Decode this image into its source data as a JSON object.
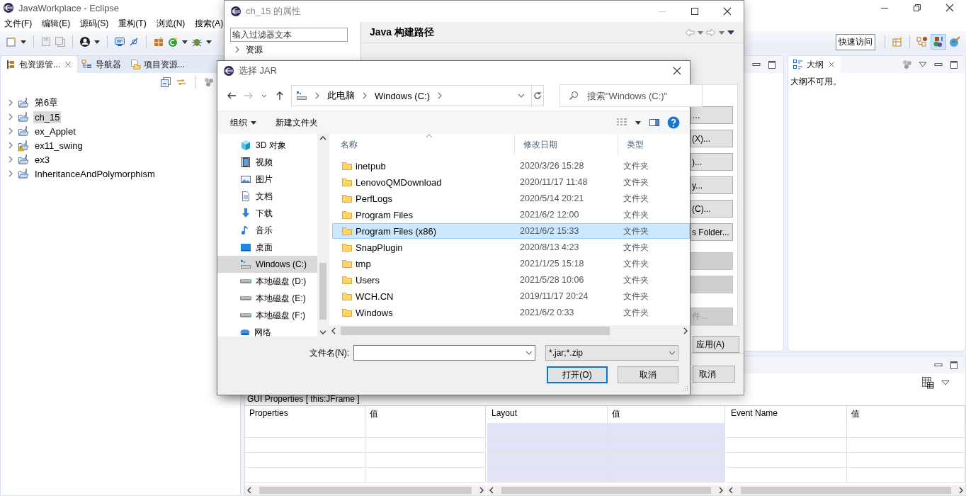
{
  "eclipse": {
    "title": "JavaWorkplace - Eclipse",
    "menu": [
      "文件(F)",
      "编辑(E)",
      "源码(S)",
      "重构(T)",
      "浏览(N)",
      "搜索(A)"
    ],
    "quick_access": "快速访问"
  },
  "package_explorer": {
    "tabs": [
      {
        "label": "包资源管...",
        "selected": true
      },
      {
        "label": "导航器",
        "selected": false
      },
      {
        "label": "项目资源...",
        "selected": false
      }
    ],
    "tree": [
      {
        "label": "第6章",
        "expanded": false,
        "selected": false,
        "warning": false
      },
      {
        "label": "ch_15",
        "expanded": false,
        "selected": true,
        "warning": false
      },
      {
        "label": "ex_Applet",
        "expanded": false,
        "selected": false,
        "warning": false
      },
      {
        "label": "ex11_swing",
        "expanded": false,
        "selected": false,
        "warning": true
      },
      {
        "label": "ex3",
        "expanded": false,
        "selected": false,
        "warning": false
      },
      {
        "label": "InheritanceAndPolymorphism",
        "expanded": false,
        "selected": false,
        "warning": false
      }
    ]
  },
  "outline": {
    "tab": "大纲",
    "message": "大纲不可用。"
  },
  "gui_properties": {
    "title": "GUI Properties [ this:JFrame ]",
    "tables": [
      {
        "columns": [
          "Properties",
          "值"
        ],
        "highlighted": false
      },
      {
        "columns": [
          "Layout",
          "值"
        ],
        "highlighted": true
      },
      {
        "columns": [
          "Event Name",
          "值"
        ],
        "highlighted": false
      }
    ]
  },
  "properties_dialog": {
    "title": "ch_15 的属性",
    "filter_placeholder": "输入过滤器文本",
    "tree": [
      {
        "label": "资源",
        "expanded": false
      }
    ],
    "page_title": "Java 构建路径",
    "buttons": [
      {
        "label": "…",
        "disabled": false
      },
      {
        "label": "(X)...",
        "disabled": false
      },
      {
        "label": ")...",
        "disabled": false
      },
      {
        "label": "y...",
        "disabled": false
      },
      {
        "label": "(C)...",
        "disabled": false
      },
      {
        "label": "s Folder...",
        "disabled": false
      },
      {
        "disabled": true
      },
      {
        "disabled": true
      },
      {
        "label": "件...",
        "disabled": true
      }
    ],
    "apply": "应用(A)",
    "cancel": "取消"
  },
  "jar_dialog": {
    "title": "选择 JAR",
    "breadcrumb": [
      "此电脑",
      "Windows (C:)"
    ],
    "search_placeholder": "搜索\"Windows (C:)\"",
    "toolbar": {
      "organize": "组织",
      "new_folder": "新建文件夹"
    },
    "nav": [
      {
        "label": "3D 对象",
        "kind": "cube",
        "selected": false
      },
      {
        "label": "视频",
        "kind": "video",
        "selected": false
      },
      {
        "label": "图片",
        "kind": "picture",
        "selected": false
      },
      {
        "label": "文档",
        "kind": "document",
        "selected": false
      },
      {
        "label": "下载",
        "kind": "download",
        "selected": false
      },
      {
        "label": "音乐",
        "kind": "music",
        "selected": false
      },
      {
        "label": "桌面",
        "kind": "desktop",
        "selected": false
      },
      {
        "label": "Windows (C:)",
        "kind": "system-drive",
        "selected": true
      },
      {
        "label": "本地磁盘 (D:)",
        "kind": "drive",
        "selected": false
      },
      {
        "label": "本地磁盘 (E:)",
        "kind": "drive",
        "selected": false
      },
      {
        "label": "本地磁盘 (F:)",
        "kind": "drive",
        "selected": false
      },
      {
        "label": "网络",
        "kind": "network",
        "selected": false
      }
    ],
    "columns": [
      "名称",
      "修改日期",
      "类型"
    ],
    "rows": [
      {
        "name": "inetpub",
        "date": "2020/3/26 15:28",
        "type": "文件夹",
        "selected": false
      },
      {
        "name": "LenovoQMDownload",
        "date": "2020/11/17 11:48",
        "type": "文件夹",
        "selected": false
      },
      {
        "name": "PerfLogs",
        "date": "2020/5/14 20:21",
        "type": "文件夹",
        "selected": false
      },
      {
        "name": "Program Files",
        "date": "2021/6/2 12:00",
        "type": "文件夹",
        "selected": false
      },
      {
        "name": "Program Files (x86)",
        "date": "2021/6/2 15:33",
        "type": "文件夹",
        "selected": true
      },
      {
        "name": "SnapPlugin",
        "date": "2020/8/13 4:23",
        "type": "文件夹",
        "selected": false
      },
      {
        "name": "tmp",
        "date": "2021/1/25 15:18",
        "type": "文件夹",
        "selected": false
      },
      {
        "name": "Users",
        "date": "2021/5/28 10:06",
        "type": "文件夹",
        "selected": false
      },
      {
        "name": "WCH.CN",
        "date": "2019/11/17 20:24",
        "type": "文件夹",
        "selected": false
      },
      {
        "name": "Windows",
        "date": "2021/6/2 0:33",
        "type": "文件夹",
        "selected": false
      }
    ],
    "filename_label": "文件名(N):",
    "file_type": "*.jar;*.zip",
    "open": "打开(O)",
    "cancel": "取消"
  }
}
